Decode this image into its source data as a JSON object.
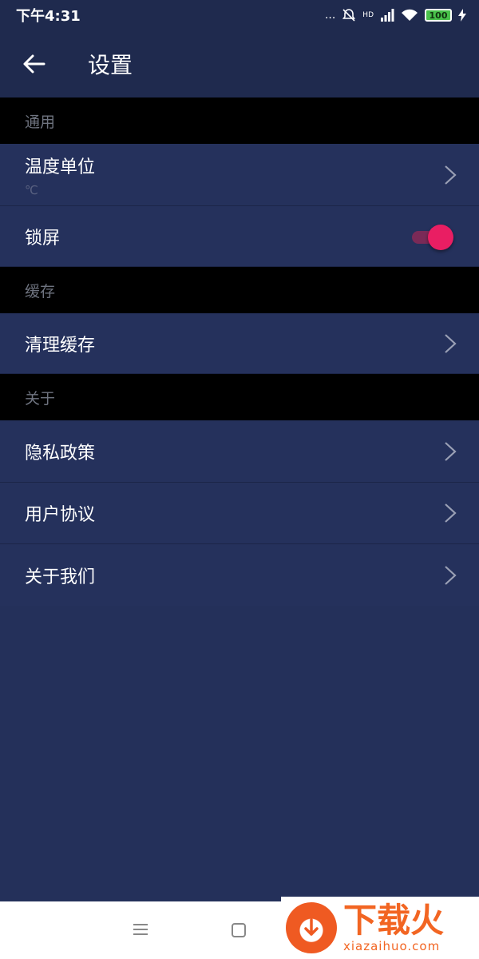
{
  "status_bar": {
    "time": "下午4:31",
    "dots": "...",
    "hd_label": "HD",
    "battery": "100"
  },
  "app_bar": {
    "title": "设置"
  },
  "sections": {
    "general": {
      "header": "通用",
      "temperature": {
        "label": "温度单位",
        "value": "℃"
      },
      "lock_screen": {
        "label": "锁屏",
        "enabled": true
      }
    },
    "cache": {
      "header": "缓存",
      "clear": {
        "label": "清理缓存"
      }
    },
    "about": {
      "header": "关于",
      "privacy": {
        "label": "隐私政策"
      },
      "agreement": {
        "label": "用户协议"
      },
      "about_us": {
        "label": "关于我们"
      }
    }
  },
  "watermark": {
    "title": "下载火",
    "site": "xiazaihuo.com"
  },
  "colors": {
    "background": "#24305a",
    "header_bar": "#1f2a4e",
    "section_header": "#000000",
    "accent": "#e91e63"
  }
}
